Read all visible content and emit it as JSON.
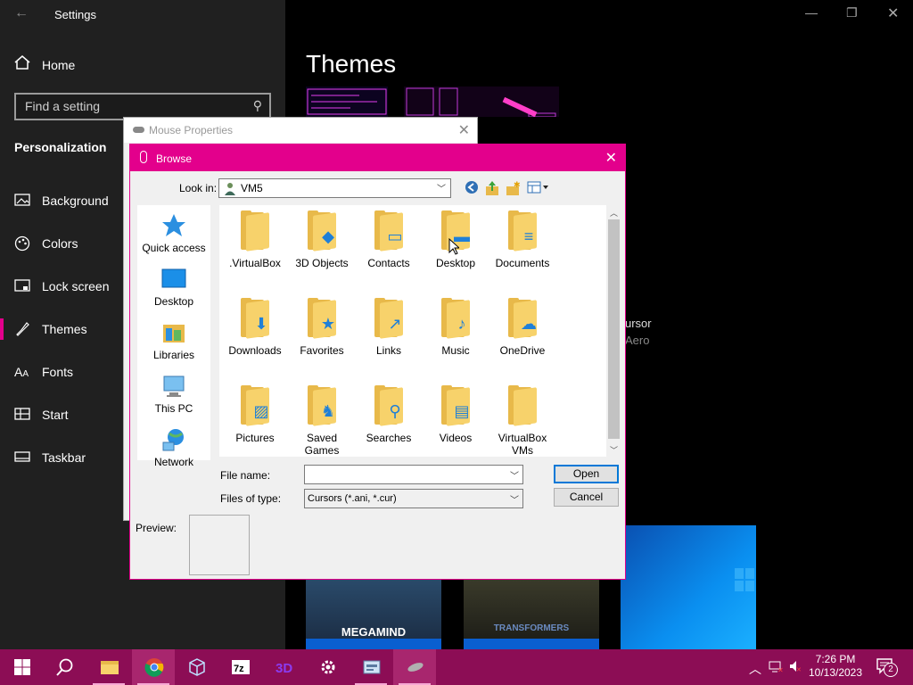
{
  "settings": {
    "title": "Settings",
    "home_label": "Home",
    "search_placeholder": "Find a setting",
    "section_title": "Personalization",
    "nav": [
      {
        "label": "Background",
        "icon": "image-icon"
      },
      {
        "label": "Colors",
        "icon": "palette-icon"
      },
      {
        "label": "Lock screen",
        "icon": "lock-screen-icon"
      },
      {
        "label": "Themes",
        "icon": "brush-icon",
        "active": true
      },
      {
        "label": "Fonts",
        "icon": "font-icon"
      },
      {
        "label": "Start",
        "icon": "start-icon"
      },
      {
        "label": "Taskbar",
        "icon": "taskbar-icon"
      }
    ],
    "page_title": "Themes",
    "partial_text_1": "ursor",
    "partial_text_2": "Aero",
    "thumb_label_1": "MEGAMIND",
    "thumb_label_2": "TRANSFORMERS",
    "accent_color": "#e3008c"
  },
  "mouse_properties": {
    "title": "Mouse Properties"
  },
  "browse": {
    "title": "Browse",
    "look_in_label": "Look in:",
    "look_in_value": "VM5",
    "places": [
      {
        "label": "Quick access",
        "icon": "star-icon"
      },
      {
        "label": "Desktop",
        "icon": "desktop-icon"
      },
      {
        "label": "Libraries",
        "icon": "libraries-icon"
      },
      {
        "label": "This PC",
        "icon": "computer-icon"
      },
      {
        "label": "Network",
        "icon": "network-icon"
      }
    ],
    "items": [
      {
        "label": ".VirtualBox",
        "icon": "folder-icon",
        "overlay": ""
      },
      {
        "label": "3D Objects",
        "icon": "folder-3d-objects-icon",
        "overlay": "◆"
      },
      {
        "label": "Contacts",
        "icon": "folder-contacts-icon",
        "overlay": "▭"
      },
      {
        "label": "Desktop",
        "icon": "folder-desktop-icon",
        "overlay": "▬"
      },
      {
        "label": "Documents",
        "icon": "folder-documents-icon",
        "overlay": "≡"
      },
      {
        "label": "Downloads",
        "icon": "folder-downloads-icon",
        "overlay": "⬇"
      },
      {
        "label": "Favorites",
        "icon": "folder-favorites-icon",
        "overlay": "★"
      },
      {
        "label": "Links",
        "icon": "folder-links-icon",
        "overlay": "↗"
      },
      {
        "label": "Music",
        "icon": "folder-music-icon",
        "overlay": "♪"
      },
      {
        "label": "OneDrive",
        "icon": "folder-onedrive-icon",
        "overlay": "☁"
      },
      {
        "label": "Pictures",
        "icon": "folder-pictures-icon",
        "overlay": "▨"
      },
      {
        "label": "Saved Games",
        "icon": "folder-saved-games-icon",
        "overlay": "♞"
      },
      {
        "label": "Searches",
        "icon": "folder-searches-icon",
        "overlay": "⚲"
      },
      {
        "label": "Videos",
        "icon": "folder-videos-icon",
        "overlay": "▤"
      },
      {
        "label": "VirtualBox VMs",
        "icon": "folder-icon",
        "overlay": ""
      }
    ],
    "file_name_label": "File name:",
    "file_name_value": "",
    "file_type_label": "Files of type:",
    "file_type_value": "Cursors (*.ani, *.cur)",
    "open_label": "Open",
    "cancel_label": "Cancel",
    "preview_label": "Preview:"
  },
  "taskbar": {
    "apps": [
      {
        "name": "start-button",
        "icon": "windows-logo-icon"
      },
      {
        "name": "search-button",
        "icon": "search-icon"
      },
      {
        "name": "file-explorer",
        "icon": "folder-icon"
      },
      {
        "name": "chrome",
        "icon": "chrome-icon"
      },
      {
        "name": "virtualbox",
        "icon": "cube-icon"
      },
      {
        "name": "7zip",
        "icon": "7zip-icon"
      },
      {
        "name": "app-3d",
        "icon": "3d-icon"
      },
      {
        "name": "settings",
        "icon": "gear-icon"
      },
      {
        "name": "control-panel",
        "icon": "control-panel-icon"
      },
      {
        "name": "mouse-properties",
        "icon": "mouse-icon"
      }
    ],
    "time": "7:26 PM",
    "date": "10/13/2023",
    "notification_count": "2"
  }
}
